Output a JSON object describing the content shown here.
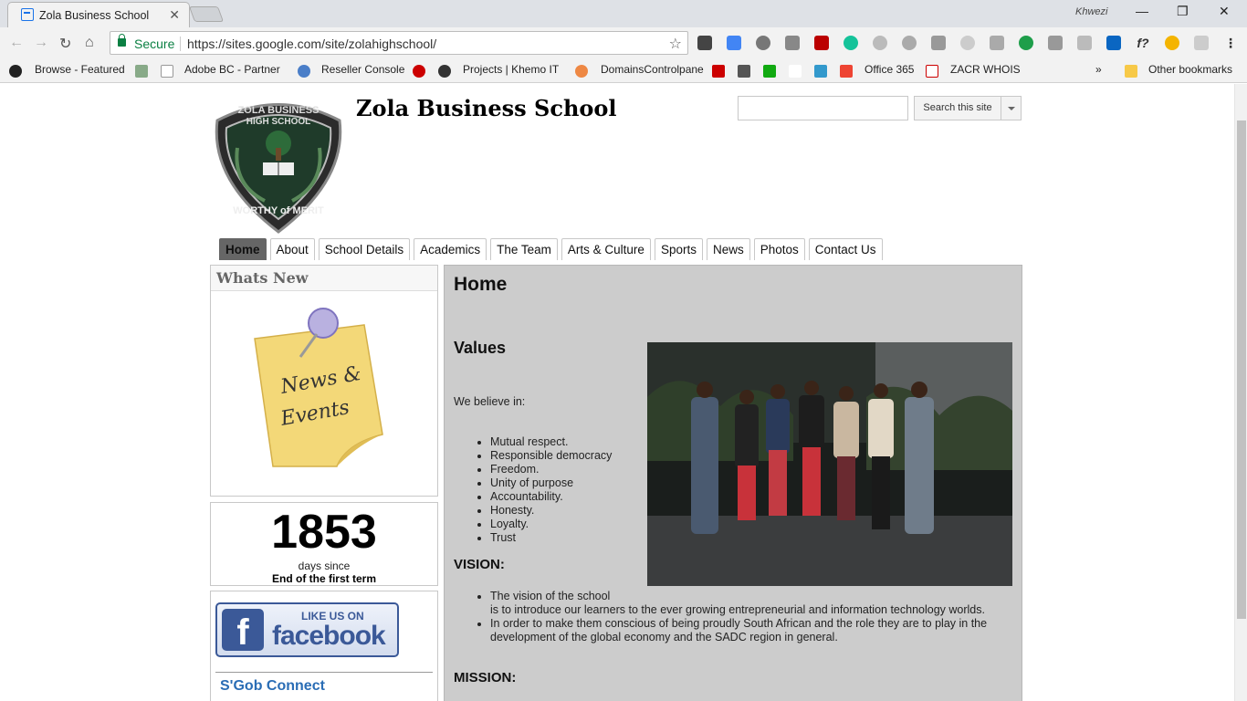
{
  "browser": {
    "tab_title": "Zola Business School",
    "user_name": "Khwezi",
    "secure_label": "Secure",
    "url": "https://sites.google.com/site/zolahighschool/",
    "bookmarks": [
      "Browse - Featured",
      "Adobe BC - Partner",
      "Reseller Console",
      "Projects | Khemo IT",
      "DomainsControlpane",
      "Office 365",
      "ZACR WHOIS",
      "Other bookmarks"
    ],
    "overflow_label": "»"
  },
  "site": {
    "title": "Zola Business School",
    "logo_text_top": "ZOLA BUSINESS HIGH SCHOOL",
    "logo_text_bottom": "WORTHY of MERIT",
    "search_button": "Search this site",
    "nav": [
      "Home",
      "About",
      "School Details",
      "Academics",
      "The Team",
      "Arts & Culture",
      "Sports",
      "News",
      "Photos",
      "Contact Us"
    ],
    "active_nav": "Home"
  },
  "sidebar": {
    "whats_new_title": "Whats New",
    "note_line1": "News &",
    "note_line2": "Events",
    "counter_value": "1853",
    "counter_unit": "days since",
    "counter_event": "End of the first term",
    "fb_like": "LIKE US ON",
    "fb_word": "facebook",
    "fb_letter": "f",
    "peek_text": "S'Gob Connect"
  },
  "content": {
    "heading": "Home",
    "values_heading": "Values",
    "believe": "We believe in:",
    "values": [
      "Mutual respect.",
      "Responsible democracy",
      "Freedom.",
      "Unity of purpose",
      "Accountability.",
      "Honesty.",
      "Loyalty.",
      "Trust"
    ],
    "vision_heading": "VISION:",
    "vision_1a": "The vision of the school",
    "vision_1b": "is to introduce our learners to the ever growing entrepreneurial and information technology worlds.",
    "vision_2": "In order to make them conscious of being proudly South African and the role they are to play in the development of the global economy and the SADC region in general.",
    "mission_heading": "MISSION:"
  },
  "colors": {
    "content_bg": "#cccccc",
    "active_tab": "#666666",
    "facebook": "#3b5998",
    "secure": "#0b8043"
  }
}
